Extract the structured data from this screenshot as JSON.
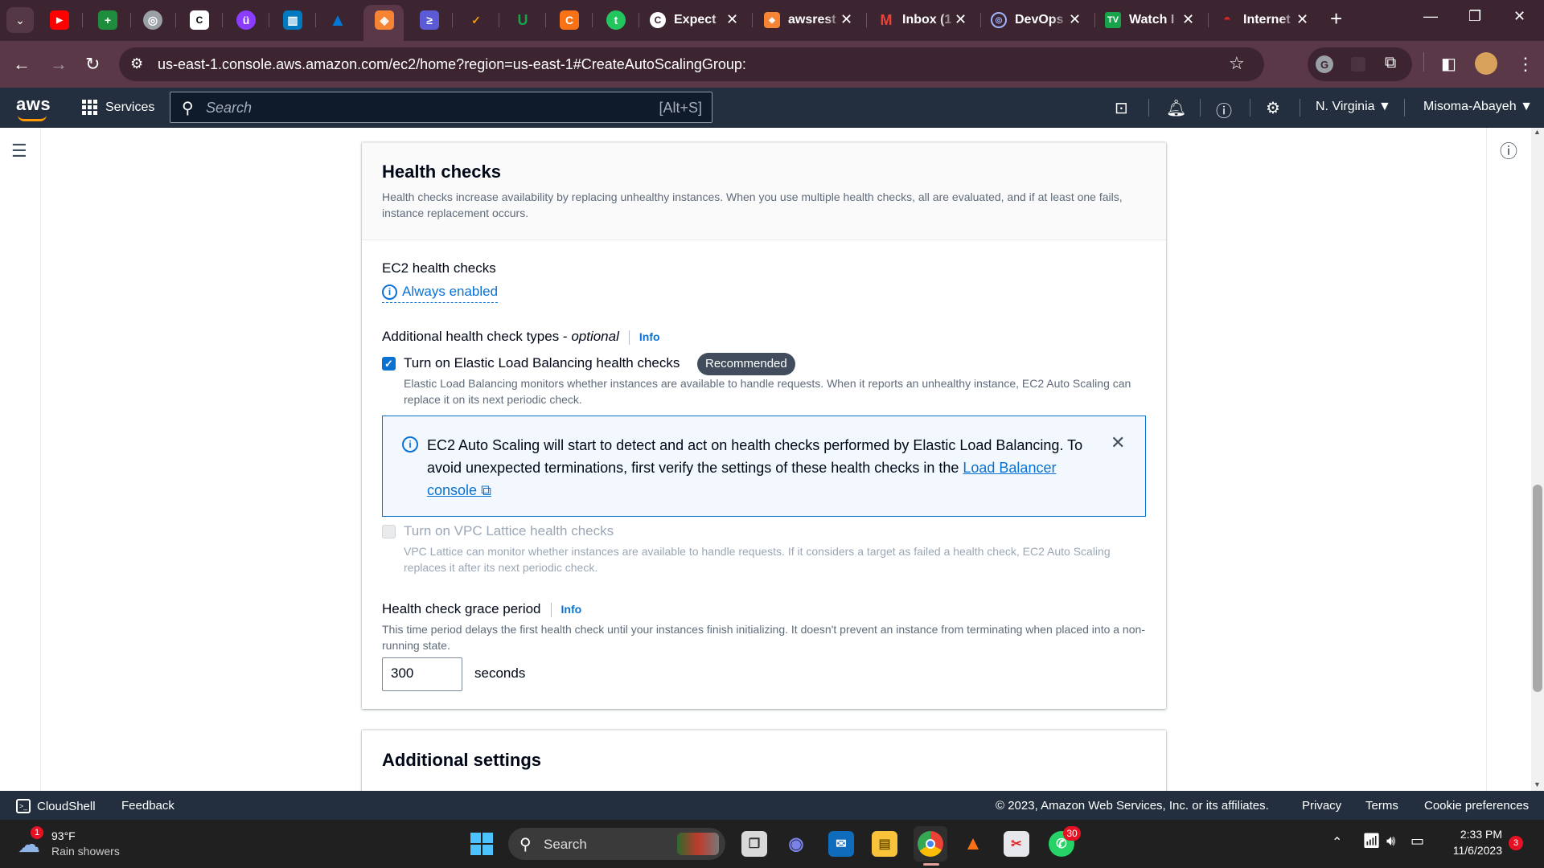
{
  "browser": {
    "tabs": [
      {
        "title": "Expect",
        "icon": "c-logo-icon"
      },
      {
        "title": "awsrest",
        "icon": "aws-orange-icon"
      },
      {
        "title": "Inbox (1",
        "icon": "gmail-icon"
      },
      {
        "title": "DevOps",
        "icon": "globe-icon"
      },
      {
        "title": "Watch I",
        "icon": "tv-icon"
      },
      {
        "title": "Internet",
        "icon": "red-icon"
      }
    ],
    "url": "us-east-1.console.aws.amazon.com/ec2/home?region=us-east-1#CreateAutoScalingGroup:"
  },
  "aws_header": {
    "logo": "aws",
    "services": "Services",
    "search_placeholder": "Search",
    "search_shortcut": "[Alt+S]",
    "region": "N. Virginia",
    "account": "Misoma-Abayeh"
  },
  "health_checks": {
    "title": "Health checks",
    "description": "Health checks increase availability by replacing unhealthy instances. When you use multiple health checks, all are evaluated, and if at least one fails, instance replacement occurs.",
    "ec2_label": "EC2 health checks",
    "ec2_value": "Always enabled",
    "additional_label": "Additional health check types - ",
    "additional_optional": "optional",
    "info": "Info",
    "elb_label": "Turn on Elastic Load Balancing health checks",
    "elb_checked": true,
    "elb_badge": "Recommended",
    "elb_desc": "Elastic Load Balancing monitors whether instances are available to handle requests. When it reports an unhealthy instance, EC2 Auto Scaling can replace it on its next periodic check.",
    "alert_text": "EC2 Auto Scaling will start to detect and act on health checks performed by Elastic Load Balancing. To avoid unexpected terminations, first verify the settings of these health checks in the ",
    "alert_link": "Load Balancer console",
    "vpc_label": "Turn on VPC Lattice health checks",
    "vpc_checked": false,
    "vpc_desc": "VPC Lattice can monitor whether instances are available to handle requests. If it considers a target as failed a health check, EC2 Auto Scaling replaces it after its next periodic check.",
    "grace_label": "Health check grace period",
    "grace_desc": "This time period delays the first health check until your instances finish initializing. It doesn't prevent an instance from terminating when placed into a non-running state.",
    "grace_value": "300",
    "grace_unit": "seconds"
  },
  "additional_settings": {
    "title": "Additional settings"
  },
  "footer": {
    "cloudshell": "CloudShell",
    "feedback": "Feedback",
    "copyright": "© 2023, Amazon Web Services, Inc. or its affiliates.",
    "privacy": "Privacy",
    "terms": "Terms",
    "cookies": "Cookie preferences"
  },
  "taskbar": {
    "weather_temp": "93°F",
    "weather_desc": "Rain showers",
    "weather_badge": "1",
    "search": "Search",
    "whatsapp_badge": "30",
    "time": "2:33 PM",
    "date": "11/6/2023",
    "notif_badge": "3"
  },
  "colors": {
    "aws_header": "#232f3e",
    "aws_orange": "#ff9900",
    "link_blue": "#0972d3",
    "tabstrip": "#3c2431",
    "addrbar": "#5a3847"
  }
}
